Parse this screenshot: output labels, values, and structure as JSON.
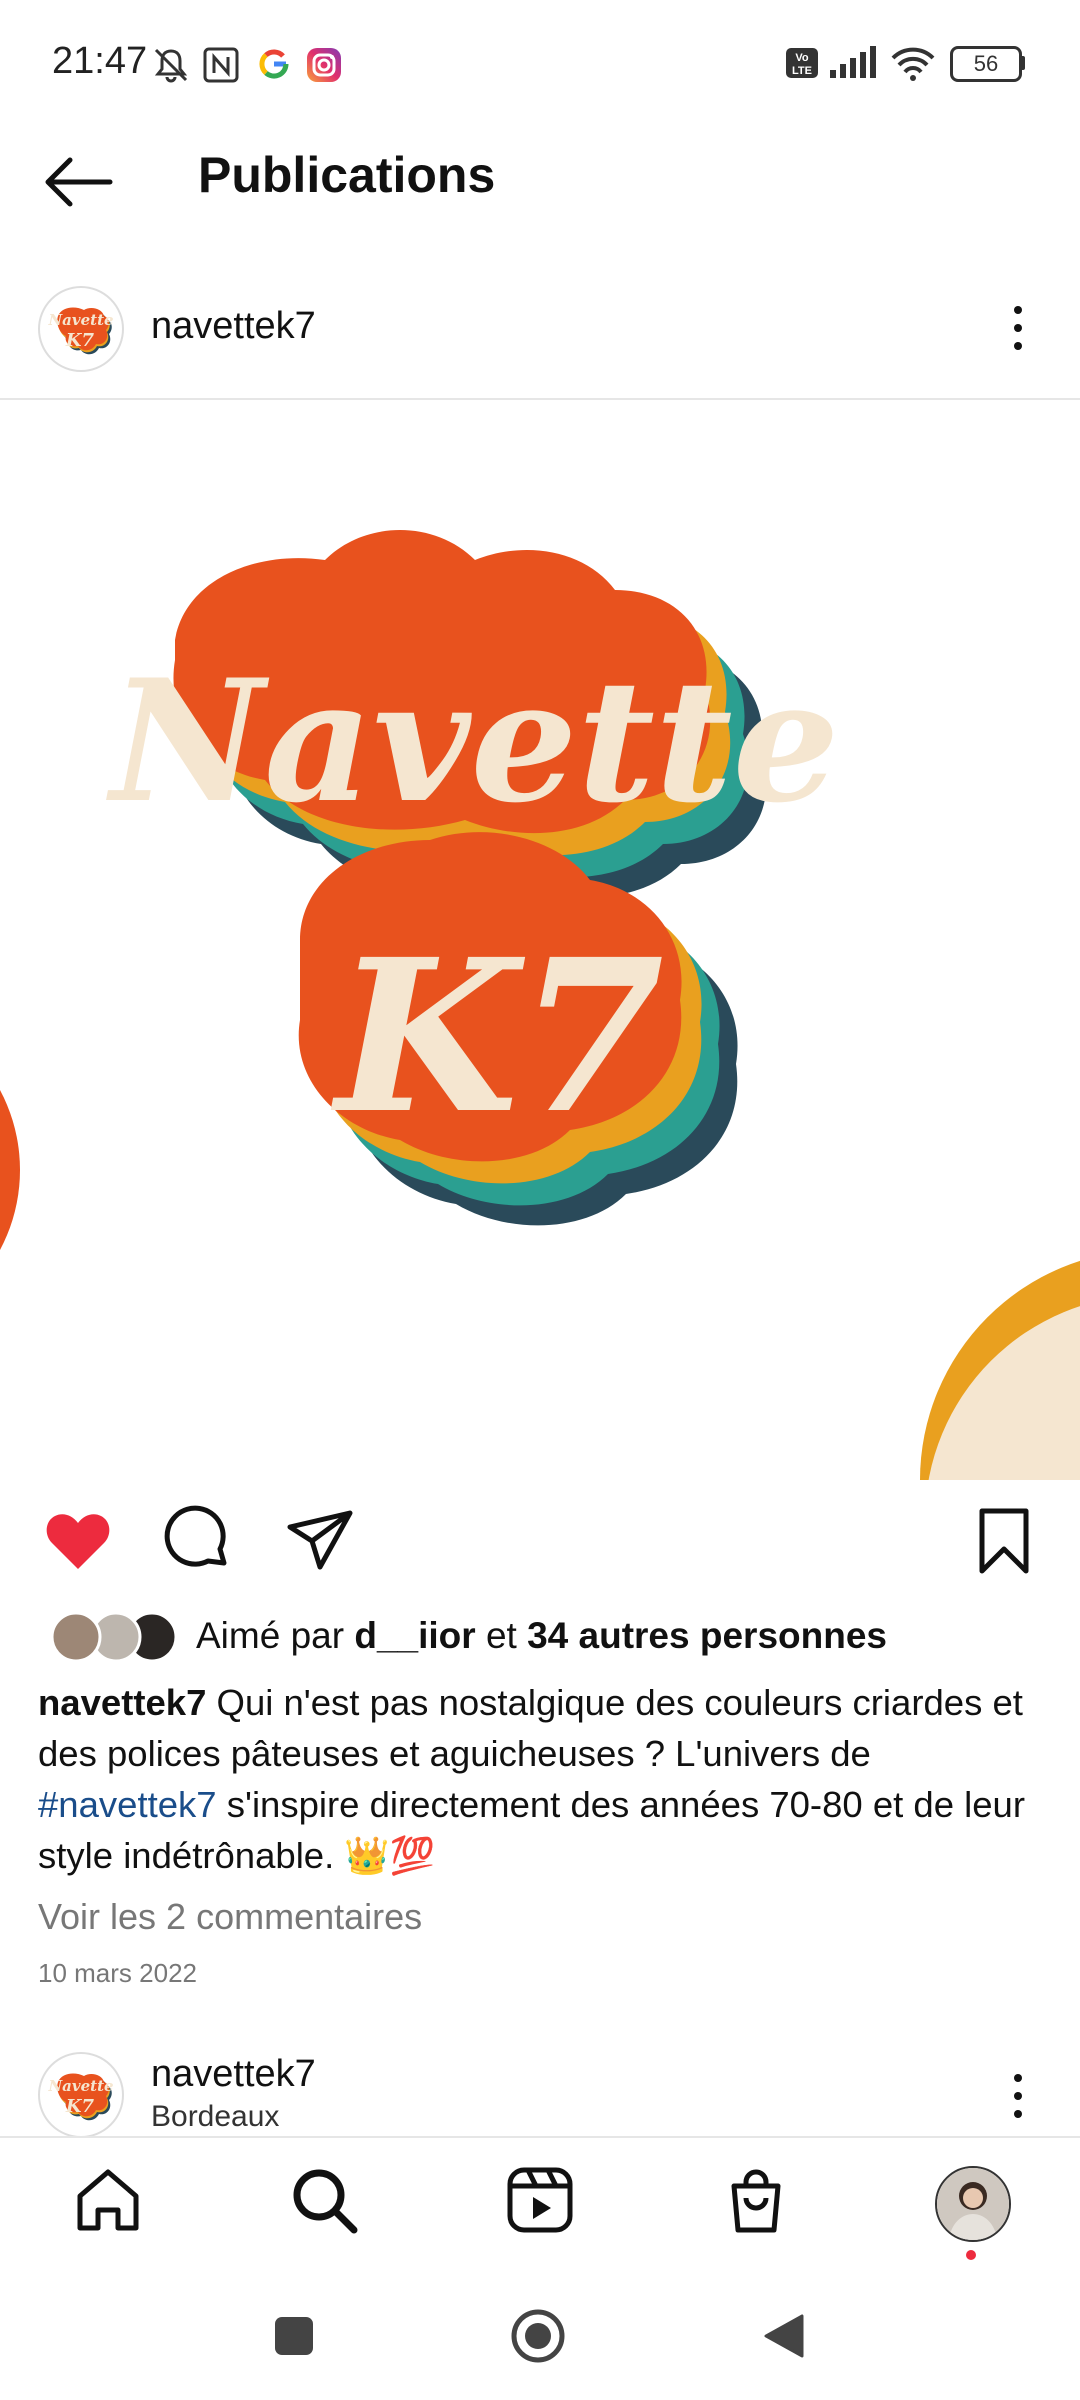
{
  "status_bar": {
    "time": "21:47",
    "icons": [
      "mute-bell-icon",
      "nfc-icon",
      "google-icon",
      "instagram-icon",
      "volte-icon",
      "signal-icon",
      "wifi-icon",
      "battery-icon"
    ],
    "battery": "56"
  },
  "header": {
    "title": "Publications",
    "back_icon": "arrow-left-icon"
  },
  "post": {
    "username": "navettek7",
    "media_logo_text": {
      "line1": "Navette",
      "line2": "K7"
    },
    "liked": true,
    "likes": {
      "prefix": "Aimé par ",
      "user": "d__iior",
      "middle": " et ",
      "others": "34 autres personnes"
    },
    "caption": {
      "user": "navettek7",
      "text1": " Qui n'est pas nostalgique des couleurs criardes et des polices pâteuses et aguicheuses ? L'univers de ",
      "hashtag": "#navettek7",
      "text2": " s'inspire directement des années 70-80 et de leur style indétrônable. 👑💯"
    },
    "view_comments": "Voir les 2 commentaires",
    "date": "10 mars 2022"
  },
  "next_post": {
    "username": "navettek7",
    "location": "Bordeaux"
  },
  "bottom_nav": {
    "items": [
      "home-icon",
      "search-icon",
      "reels-icon",
      "shop-icon",
      "profile-avatar"
    ]
  },
  "colors": {
    "orange": "#e8521e",
    "yellow": "#e9a01f",
    "teal": "#2b9f91",
    "navy": "#2a4a5a",
    "cream": "#f5e6d0",
    "like_red": "#ed2b3e"
  }
}
